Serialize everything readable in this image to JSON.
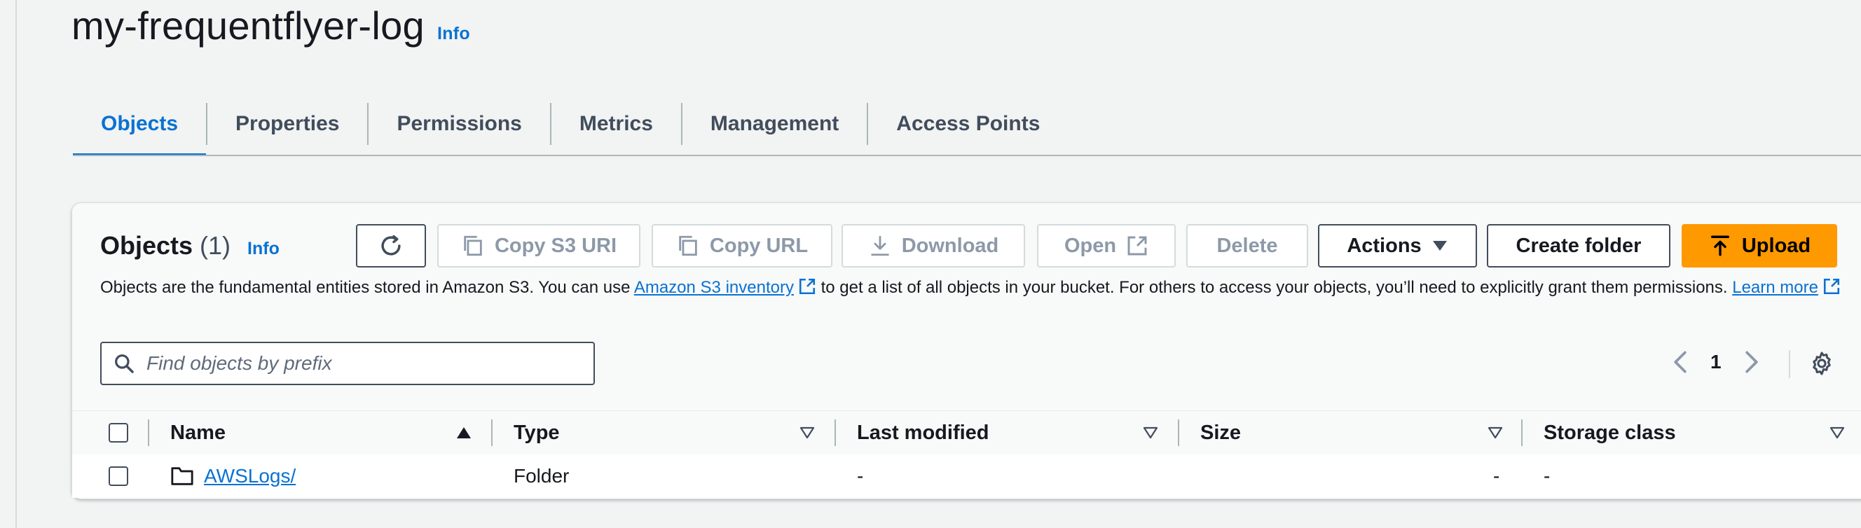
{
  "page": {
    "title": "my-frequentflyer-log",
    "info_label": "Info"
  },
  "tabs": [
    {
      "label": "Objects",
      "active": true
    },
    {
      "label": "Properties",
      "active": false
    },
    {
      "label": "Permissions",
      "active": false
    },
    {
      "label": "Metrics",
      "active": false
    },
    {
      "label": "Management",
      "active": false
    },
    {
      "label": "Access Points",
      "active": false
    }
  ],
  "objects_panel": {
    "heading": "Objects",
    "count": "(1)",
    "info_label": "Info",
    "toolbar": {
      "refresh_icon": "refresh-icon",
      "copy_s3_uri": "Copy S3 URI",
      "copy_url": "Copy URL",
      "download": "Download",
      "open": "Open",
      "delete": "Delete",
      "actions": "Actions",
      "create_folder": "Create folder",
      "upload": "Upload"
    },
    "description": {
      "text_1": "Objects are the fundamental entities stored in Amazon S3. You can use ",
      "link_1": "Amazon S3 inventory",
      "text_2": " to get a list of all objects in your bucket. For others to access your objects, you’ll need to explicitly grant them permissions. ",
      "link_2": "Learn more"
    },
    "search": {
      "placeholder": "Find objects by prefix",
      "value": ""
    },
    "pagination": {
      "current_page": "1"
    },
    "table": {
      "columns": [
        "Name",
        "Type",
        "Last modified",
        "Size",
        "Storage class"
      ],
      "rows": [
        {
          "name": "AWSLogs/",
          "type": "Folder",
          "last_modified": "-",
          "size": "-",
          "storage_class": "-"
        }
      ]
    }
  },
  "colors": {
    "accent_link": "#0972d3",
    "primary_button": "#ff9900",
    "text": "#16191f",
    "disabled_text": "#8d99a8",
    "border": "#414d5c"
  }
}
